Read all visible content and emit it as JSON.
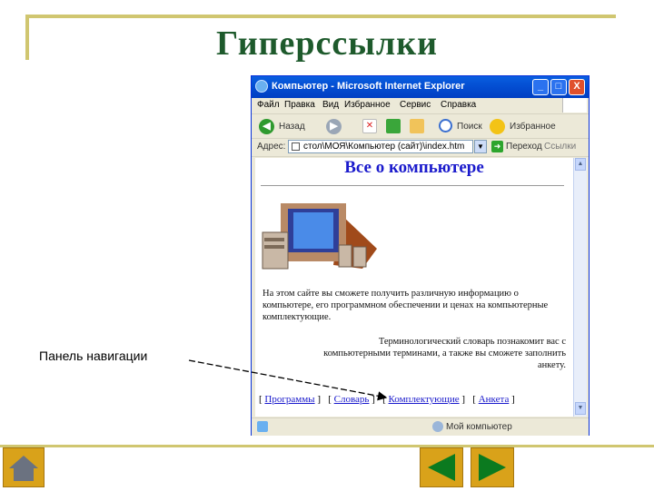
{
  "slide": {
    "title": "Гиперссылки",
    "annotation_label": "Панель навигации",
    "accent_color": "#d0c670",
    "title_color": "#1e5a2c",
    "nav_buttons": {
      "home_icon": "home-icon",
      "back_icon": "triangle-left-icon",
      "forward_icon": "triangle-right-icon",
      "button_color": "#d9a21a",
      "glyph_color": "#0b7a1f"
    }
  },
  "browser": {
    "title": "Компьютер - Microsoft Internet Explorer",
    "window_buttons": {
      "minimize": "_",
      "maximize": "□",
      "close": "X"
    },
    "menu": [
      "Файл",
      "Правка",
      "Вид",
      "Избранное",
      "Сервис",
      "Справка"
    ],
    "toolbar": {
      "back": "Назад",
      "search": "Поиск",
      "favorites": "Избранное"
    },
    "address": {
      "label": "Адрес:",
      "value": "стол\\МОЯ\\Компьютер (сайт)\\index.htm",
      "go": "Переход",
      "links": "Ссылки"
    },
    "status": {
      "zone": "Мой компьютер"
    }
  },
  "page": {
    "heading": "Все о компьютере",
    "intro": "На этом сайте вы сможете получить различную информацию о компьютере, его программном обеспечении и ценах на компьютерные комплектующие.",
    "glossary_text": "Терминологический словарь познакомит вас с компьютерными терминами, а также вы сможете заполнить анкету.",
    "nav_links": [
      "Программы",
      "Словарь",
      "Комплектующие",
      "Анкета"
    ],
    "heading_color": "#1a1acc"
  }
}
